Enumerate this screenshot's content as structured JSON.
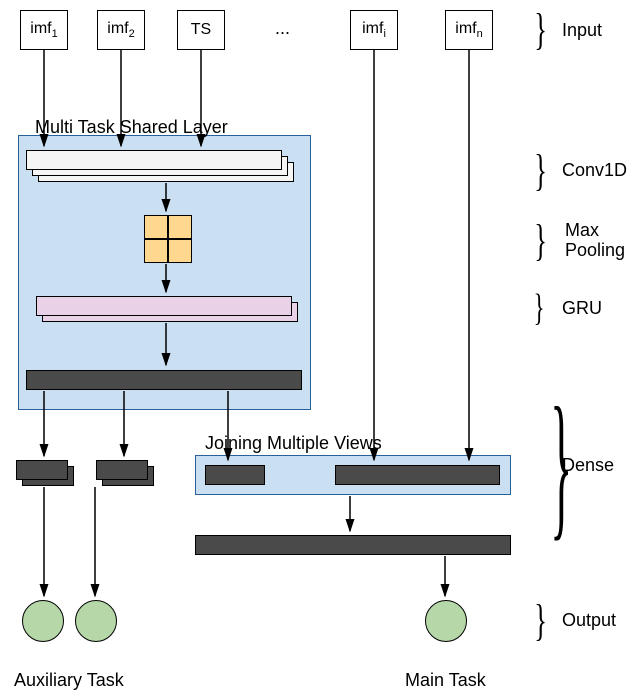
{
  "inputs": {
    "imf1": "imf",
    "imf1_sub": "1",
    "imf2": "imf",
    "imf2_sub": "2",
    "ts": "TS",
    "dots": "...",
    "imfi": "imf",
    "imfi_sub": "i",
    "imfn": "imf",
    "imfn_sub": "n"
  },
  "labels": {
    "shared": "Multi Task Shared Layer",
    "joining": "Joining Multiple Views",
    "aux": "Auxiliary Task",
    "main": "Main Task"
  },
  "rlabels": {
    "input": "Input",
    "conv": "Conv1D",
    "pool": "Max\nPooling",
    "pool1": "Max",
    "pool2": "Pooling",
    "gru": "GRU",
    "dense": "Dense",
    "output": "Output"
  },
  "chart_data": {
    "type": "diagram",
    "title": "Multi-task neural network architecture",
    "inputs": [
      "imf1",
      "imf2",
      "TS",
      "...",
      "imfi",
      "imfn"
    ],
    "shared_layer_block": {
      "label": "Multi Task Shared Layer",
      "layers": [
        {
          "name": "Conv1D",
          "stacks": 3,
          "color": "light-gray"
        },
        {
          "name": "Max Pooling",
          "grid": "2x2",
          "color": "orange"
        },
        {
          "name": "GRU",
          "stacks": 2,
          "color": "purple"
        },
        {
          "name": "Dense",
          "stacks": 1,
          "color": "dark-gray"
        }
      ]
    },
    "joining_block": {
      "label": "Joining Multiple Views",
      "layers": [
        {
          "name": "Dense",
          "stacks": 2,
          "color": "dark-gray"
        }
      ]
    },
    "auxiliary_task": {
      "label": "Auxiliary Task",
      "dense_branches": 2,
      "dense_stacks_each": 2,
      "outputs": 2
    },
    "main_task": {
      "label": "Main Task",
      "dense_after_join": 1,
      "outputs": 1
    },
    "right_annotations": [
      "Input",
      "Conv1D",
      "Max Pooling",
      "GRU",
      "Dense",
      "Output"
    ],
    "arrows": [
      "imf1 -> SharedLayer",
      "imf2 -> SharedLayer",
      "TS -> SharedLayer",
      "imfi -> Joining",
      "imfn -> Joining",
      "SharedLayer.Conv1D -> MaxPooling -> GRU -> Dense",
      "SharedDense -> AuxDense1",
      "SharedDense -> AuxDense2",
      "SharedDense -> Joining",
      "AuxDense1 -> Output1",
      "AuxDense2 -> Output2",
      "Joining -> MainDense -> MainOutput"
    ]
  }
}
